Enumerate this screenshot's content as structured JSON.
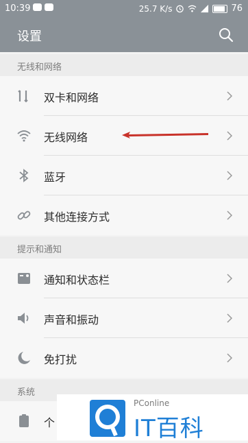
{
  "status_bar": {
    "time": "10:39",
    "network_speed": "25.7 K/s",
    "battery": "76"
  },
  "app_bar": {
    "title": "设置",
    "search_icon": "search-icon"
  },
  "sections": [
    {
      "header": "无线和网络",
      "items": [
        {
          "label": "双卡和网络",
          "icon": "dual-sim-icon"
        },
        {
          "label": "无线网络",
          "icon": "wifi-icon"
        },
        {
          "label": "蓝牙",
          "icon": "bluetooth-icon"
        },
        {
          "label": "其他连接方式",
          "icon": "link-icon"
        }
      ]
    },
    {
      "header": "提示和通知",
      "items": [
        {
          "label": "通知和状态栏",
          "icon": "notification-icon"
        },
        {
          "label": "声音和振动",
          "icon": "speaker-icon"
        },
        {
          "label": "免打扰",
          "icon": "moon-icon"
        }
      ]
    },
    {
      "header": "系统",
      "items": [
        {
          "label": "个",
          "icon": "clipboard-icon"
        }
      ]
    }
  ],
  "watermark": {
    "sub": "PConline",
    "main": "IT百科"
  },
  "colors": {
    "header_bg": "#8a9197",
    "annotation_arrow": "#c8322a",
    "watermark_blue": "#1f7fd6"
  }
}
